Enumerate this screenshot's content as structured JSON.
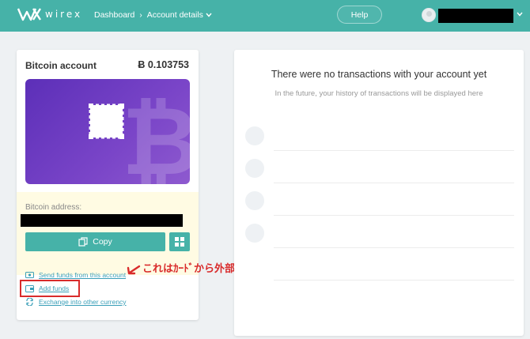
{
  "header": {
    "logo_text": "wirex",
    "breadcrumb": {
      "dashboard": "Dashboard",
      "separator": "›",
      "current": "Account details"
    },
    "help_label": "Help"
  },
  "account_card": {
    "title": "Bitcoin account",
    "balance": "Ƀ 0.103753",
    "address_label": "Bitcoin address:",
    "copy_label": "Copy",
    "links": [
      {
        "label": "Send funds from this account",
        "icon": "send-icon"
      },
      {
        "label": "Add funds",
        "icon": "wallet-icon"
      },
      {
        "label": "Exchange into other currency",
        "icon": "exchange-icon"
      }
    ]
  },
  "annotation": {
    "text": "これはｶｰﾄﾞから外部への送金"
  },
  "transactions": {
    "empty_title": "There were no transactions with your account yet",
    "empty_subtitle": "In the future, your history of transactions will be displayed here"
  },
  "colors": {
    "brand": "#46b2a8",
    "card_purple": "#6a3cc0",
    "link": "#3a9fb8",
    "annotation": "#d92b2b",
    "address_bg": "#fffbe3"
  }
}
